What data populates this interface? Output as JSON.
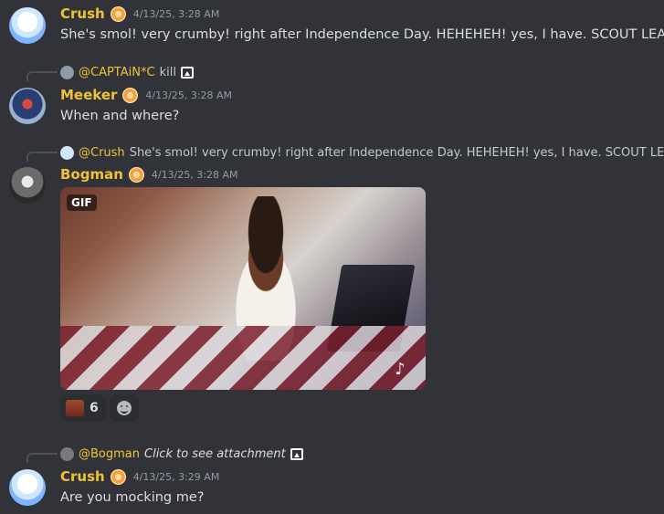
{
  "messages": [
    {
      "username": "Crush",
      "timestamp": "4/13/25, 3:28 AM",
      "text": "She's smol! very crumby! right after Independence Day. HEHEHEH! yes, I have. SCOUT LEADER"
    },
    {
      "reply_to": {
        "mention": "@CAPTAiN*C",
        "text": "kill"
      },
      "username": "Meeker",
      "timestamp": "4/13/25, 3:28 AM",
      "text": "When and where?"
    },
    {
      "reply_to": {
        "mention": "@Crush",
        "text": "She's smol! very crumby! right after Independence Day. HEHEHEH! yes, I have. SCOUT LEADER"
      },
      "username": "Bogman",
      "timestamp": "4/13/25, 3:28 AM",
      "attachment": {
        "type": "gif",
        "badge": "GIF"
      },
      "reactions": [
        {
          "emoji": "reaction-face-emoji",
          "count": "6"
        }
      ]
    },
    {
      "reply_to": {
        "mention": "@Bogman",
        "text": "Click to see attachment"
      },
      "username": "Crush",
      "timestamp": "4/13/25, 3:29 AM",
      "text": "Are you mocking me?"
    }
  ],
  "colors": {
    "background": "#313338",
    "username": "#f0c337",
    "timestamp": "#949ba4",
    "text": "#dbdee1"
  }
}
